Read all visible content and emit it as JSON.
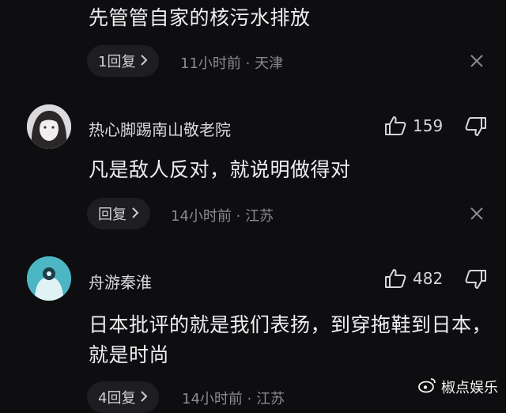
{
  "comments": [
    {
      "text": "先管管自家的核污水排放",
      "reply_label": "1回复",
      "time": "11小时前",
      "location": "天津"
    },
    {
      "username": "热心脚踢南山敬老院",
      "likes": "159",
      "text": "凡是敌人反对，就说明做得对",
      "reply_label": "回复",
      "time": "14小时前",
      "location": "江苏"
    },
    {
      "username": "舟游秦淮",
      "likes": "482",
      "text": "日本批评的就是我们表扬，到穿拖鞋到日本，就是时尚",
      "reply_label": "4回复",
      "time": "14小时前",
      "location": "江苏"
    }
  ],
  "separator": "·",
  "watermark": "椒点娱乐",
  "icons": {
    "like": "thumbs-up-icon",
    "dislike": "thumbs-down-icon",
    "chevron": "chevron-right-icon",
    "close": "close-icon",
    "brand": "weibo-logo-icon"
  },
  "colors": {
    "background": "#0e0d0f",
    "text": "#efeff1",
    "meta": "#8b8a90",
    "pill": "#1e1d21",
    "avatar_teal": "#4db6c4"
  }
}
